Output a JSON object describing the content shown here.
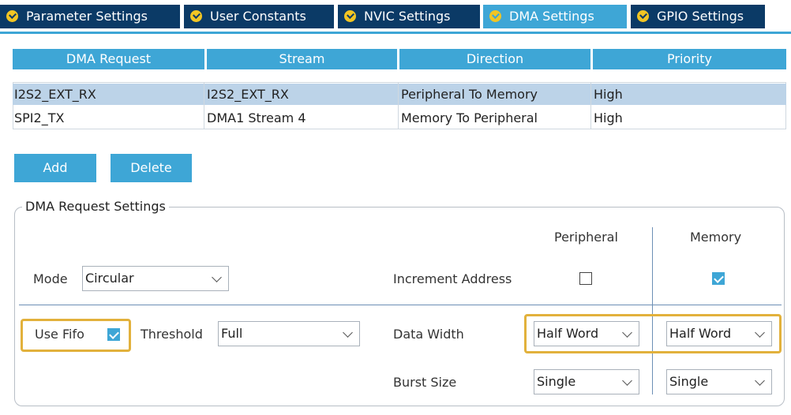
{
  "tabs": [
    {
      "label": "Parameter Settings",
      "active": false
    },
    {
      "label": "User Constants",
      "active": false
    },
    {
      "label": "NVIC Settings",
      "active": false
    },
    {
      "label": "DMA Settings",
      "active": true
    },
    {
      "label": "GPIO Settings",
      "active": false
    }
  ],
  "table": {
    "columns": [
      "DMA Request",
      "Stream",
      "Direction",
      "Priority"
    ],
    "rows": [
      {
        "request": "I2S2_EXT_RX",
        "stream": "I2S2_EXT_RX",
        "direction": "Peripheral To Memory",
        "priority": "High",
        "selected": true
      },
      {
        "request": "SPI2_TX",
        "stream": "DMA1 Stream 4",
        "direction": "Memory To Peripheral",
        "priority": "High",
        "selected": false
      }
    ]
  },
  "buttons": {
    "add": "Add",
    "delete": "Delete"
  },
  "settings": {
    "title": "DMA Request Settings",
    "col_peripheral": "Peripheral",
    "col_memory": "Memory",
    "mode_label": "Mode",
    "mode_value": "Circular",
    "increment_label": "Increment Address",
    "increment_peripheral": false,
    "increment_memory": true,
    "use_fifo_label": "Use Fifo",
    "use_fifo": true,
    "threshold_label": "Threshold",
    "threshold_value": "Full",
    "data_width_label": "Data Width",
    "data_width_peripheral": "Half Word",
    "data_width_memory": "Half Word",
    "burst_size_label": "Burst Size",
    "burst_peripheral": "Single",
    "burst_memory": "Single"
  },
  "colors": {
    "tab_bg": "#0b3a66",
    "accent": "#3ea6d6",
    "selected_row": "#bcd3e8",
    "highlight": "#e2b13c",
    "check_icon": "#f2c523"
  }
}
